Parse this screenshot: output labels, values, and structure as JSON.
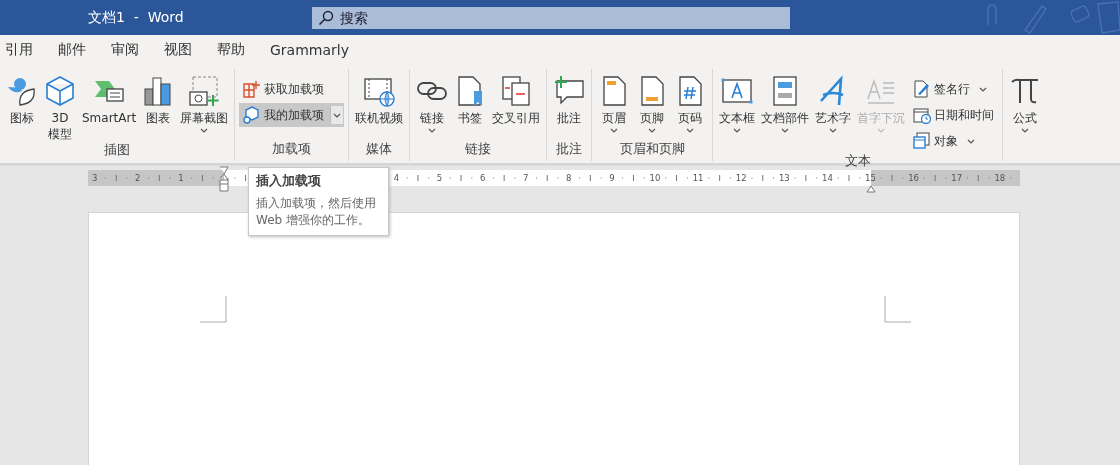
{
  "window": {
    "title": "文档1  -  Word"
  },
  "search": {
    "placeholder": "搜索"
  },
  "tabs": [
    {
      "label": "引用"
    },
    {
      "label": "邮件"
    },
    {
      "label": "审阅"
    },
    {
      "label": "视图"
    },
    {
      "label": "帮助"
    },
    {
      "label": "Grammarly"
    }
  ],
  "ribbon": {
    "groups": [
      {
        "label": "插图",
        "items": [
          {
            "kind": "large",
            "label": "图标"
          },
          {
            "kind": "large",
            "label": "3D模型"
          },
          {
            "kind": "large",
            "label": "SmartArt"
          },
          {
            "kind": "large",
            "label": "图表"
          },
          {
            "kind": "large",
            "label": "屏幕截图",
            "dropdown": true
          }
        ]
      },
      {
        "label": "加载项",
        "items": [
          {
            "kind": "stack",
            "children": [
              {
                "label": "获取加载项",
                "highlighted": false
              },
              {
                "label": "我的加载项",
                "highlighted": true,
                "dropdown": true
              }
            ]
          }
        ]
      },
      {
        "label": "媒体",
        "items": [
          {
            "kind": "large",
            "label": "联机视频"
          }
        ]
      },
      {
        "label": "链接",
        "items": [
          {
            "kind": "large",
            "label": "链接",
            "dropdown": true
          },
          {
            "kind": "large",
            "label": "书签"
          },
          {
            "kind": "large",
            "label": "交叉引用"
          }
        ]
      },
      {
        "label": "批注",
        "items": [
          {
            "kind": "large",
            "label": "批注"
          }
        ]
      },
      {
        "label": "页眉和页脚",
        "items": [
          {
            "kind": "large",
            "label": "页眉",
            "dropdown": true
          },
          {
            "kind": "large",
            "label": "页脚",
            "dropdown": true
          },
          {
            "kind": "large",
            "label": "页码",
            "dropdown": true
          }
        ]
      },
      {
        "label": "文本",
        "items": [
          {
            "kind": "large",
            "label": "文本框",
            "dropdown": true
          },
          {
            "kind": "large",
            "label": "文档部件",
            "dropdown": true
          },
          {
            "kind": "large",
            "label": "艺术字",
            "dropdown": true
          },
          {
            "kind": "large",
            "label": "首字下沉",
            "dropdown": true,
            "disabled": true
          },
          {
            "kind": "stack",
            "children": [
              {
                "label": "签名行",
                "dropdown": true
              },
              {
                "label": "日期和时间"
              },
              {
                "label": "对象",
                "dropdown": true
              }
            ]
          }
        ]
      },
      {
        "items": [
          {
            "kind": "large",
            "label": "公式",
            "dropdown": true
          }
        ]
      }
    ]
  },
  "ruler": {
    "left_numbers": [
      "3",
      "2",
      "1"
    ],
    "numbers": [
      "4",
      "5",
      "6",
      "7",
      "8",
      "9",
      "10",
      "11",
      "12",
      "13",
      "14",
      "15",
      "16",
      "17",
      "18"
    ]
  },
  "tooltip": {
    "title": "插入加载项",
    "body": "插入加载项，然后使用Web 增强你的工作。"
  }
}
